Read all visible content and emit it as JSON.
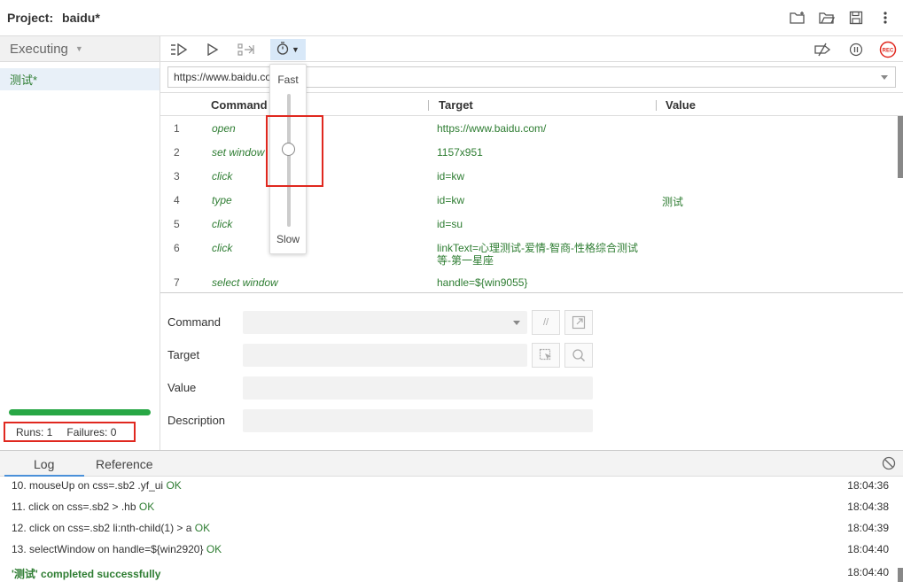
{
  "header": {
    "project_label": "Project:",
    "project_name": "baidu*"
  },
  "sidebar": {
    "executing_label": "Executing",
    "tests": [
      {
        "name": "测试*"
      }
    ],
    "progress_fraction": 1.0,
    "runs_label": "Runs: 1",
    "failures_label": "Failures: 0"
  },
  "url": {
    "value": "https://www.baidu.co"
  },
  "table": {
    "headers": {
      "command": "Command",
      "target": "Target",
      "value": "Value"
    },
    "rows": [
      {
        "num": "1",
        "command": "open",
        "target": "https://www.baidu.com/",
        "value": ""
      },
      {
        "num": "2",
        "command": "set window",
        "target": "1157x951",
        "value": ""
      },
      {
        "num": "3",
        "command": "click",
        "target": "id=kw",
        "value": ""
      },
      {
        "num": "4",
        "command": "type",
        "target": "id=kw",
        "value": "测试"
      },
      {
        "num": "5",
        "command": "click",
        "target": "id=su",
        "value": ""
      },
      {
        "num": "6",
        "command": "click",
        "target": "linkText=心理测试-爱情-智商-性格综合测试等-第一星座",
        "value": ""
      },
      {
        "num": "7",
        "command": "select window",
        "target": "handle=${win9055}",
        "value": ""
      }
    ]
  },
  "speed": {
    "fast_label": "Fast",
    "slow_label": "Slow",
    "level_fraction": 0.6
  },
  "editor": {
    "command_label": "Command",
    "target_label": "Target",
    "value_label": "Value",
    "description_label": "Description",
    "comment_glyph": "//"
  },
  "bottom": {
    "tab_log": "Log",
    "tab_reference": "Reference",
    "log": [
      {
        "text": "10. mouseUp on css=.sb2 .yf_ui",
        "status": "OK",
        "time": "18:04:36"
      },
      {
        "text": "11. click on css=.sb2 > .hb",
        "status": "OK",
        "time": "18:04:38"
      },
      {
        "text": "12. click on css=.sb2 li:nth-child(1) > a",
        "status": "OK",
        "time": "18:04:39"
      },
      {
        "text": "13. selectWindow on handle=${win2920}",
        "status": "OK",
        "time": "18:04:40"
      }
    ],
    "final": {
      "text": "'测试' completed successfully",
      "time": "18:04:40"
    }
  },
  "colors": {
    "accent": "#2e7d32",
    "highlight": "#e0281f",
    "progress": "#28a745",
    "record": "#e0281f"
  },
  "icons": [
    "new-project-icon",
    "open-project-icon",
    "save-project-icon",
    "more-options-icon",
    "run-all-icon",
    "run-icon",
    "step-icon",
    "speed-icon",
    "disable-breakpoints-icon",
    "pause-icon",
    "record-icon",
    "clear-log-icon"
  ]
}
